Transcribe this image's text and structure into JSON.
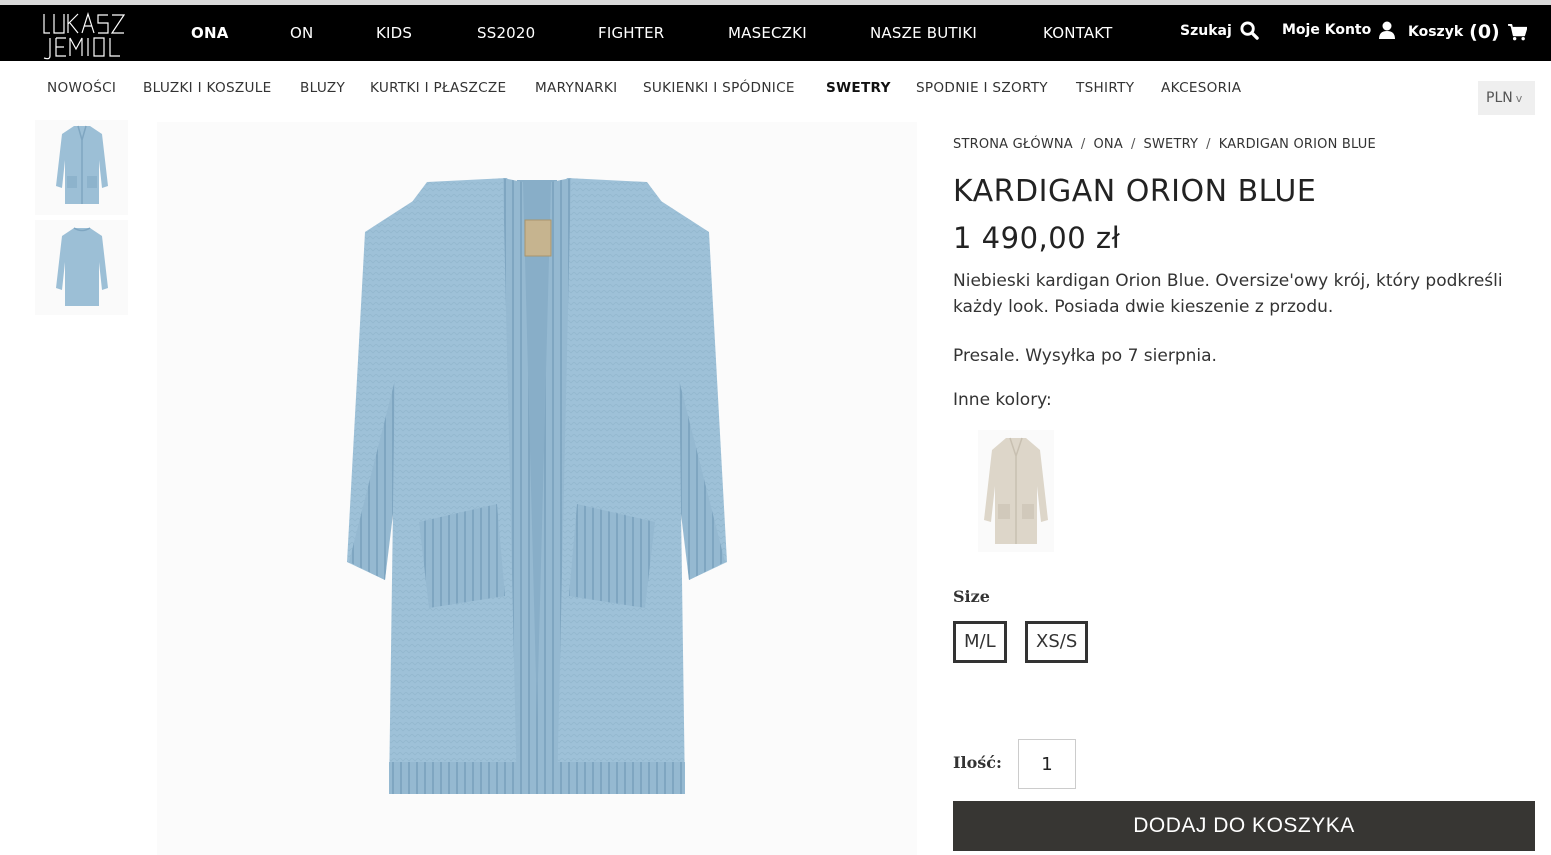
{
  "brand": {
    "logo_text": "ŁUKASZ JEMIOŁ"
  },
  "header": {
    "nav": [
      {
        "label": "ONA",
        "active": true
      },
      {
        "label": "ON"
      },
      {
        "label": "KIDS"
      },
      {
        "label": "SS2020"
      },
      {
        "label": "FIGHTER"
      },
      {
        "label": "MASECZKI"
      },
      {
        "label": "NASZE BUTIKI"
      },
      {
        "label": "KONTAKT"
      }
    ],
    "search_label": "Szukaj",
    "account_label": "Moje Konto",
    "cart_label": "Koszyk",
    "cart_count": "(0)"
  },
  "categories": [
    {
      "label": "NOWOŚCI"
    },
    {
      "label": "BLUZKI I KOSZULE"
    },
    {
      "label": "BLUZY"
    },
    {
      "label": "KURTKI I PŁASZCZE"
    },
    {
      "label": "MARYNARKI"
    },
    {
      "label": "SUKIENKI I SPÓDNICE"
    },
    {
      "label": "SWETRY",
      "active": true
    },
    {
      "label": "SPODNIE I SZORTY"
    },
    {
      "label": "TSHIRTY"
    },
    {
      "label": "AKCESORIA"
    }
  ],
  "currency": {
    "value": "PLN",
    "caret": "v"
  },
  "breadcrumb": [
    "STRONA GŁÓWNA",
    "ONA",
    "SWETRY",
    "KARDIGAN ORION BLUE"
  ],
  "breadcrumb_sep": "/",
  "product": {
    "title": "KARDIGAN ORION BLUE",
    "price": "1 490,00 zł",
    "description": "Niebieski kardigan Orion Blue. Oversize'owy krój, który podkreśli każdy look. Posiada dwie kieszenie z przodu.",
    "presale": "Presale. Wysyłka po 7 sierpnia.",
    "other_colors_label": "Inne kolory:",
    "size_label": "Size",
    "sizes": [
      "M/L",
      "XS/S"
    ],
    "qty_label": "Ilość:",
    "qty_value": "1",
    "add_to_cart": "DODAJ DO KOSZYKA"
  },
  "colors": {
    "topbar_bg": "#000000",
    "cardigan_blue": "#9cbfd6",
    "cardigan_blue_dark": "#7fa6c1",
    "swatch_beige": "#ddd6c9",
    "button_dark": "#373633"
  },
  "icons": {
    "search": "magnifier-icon",
    "account": "user-icon",
    "cart": "shopping-cart-icon"
  }
}
